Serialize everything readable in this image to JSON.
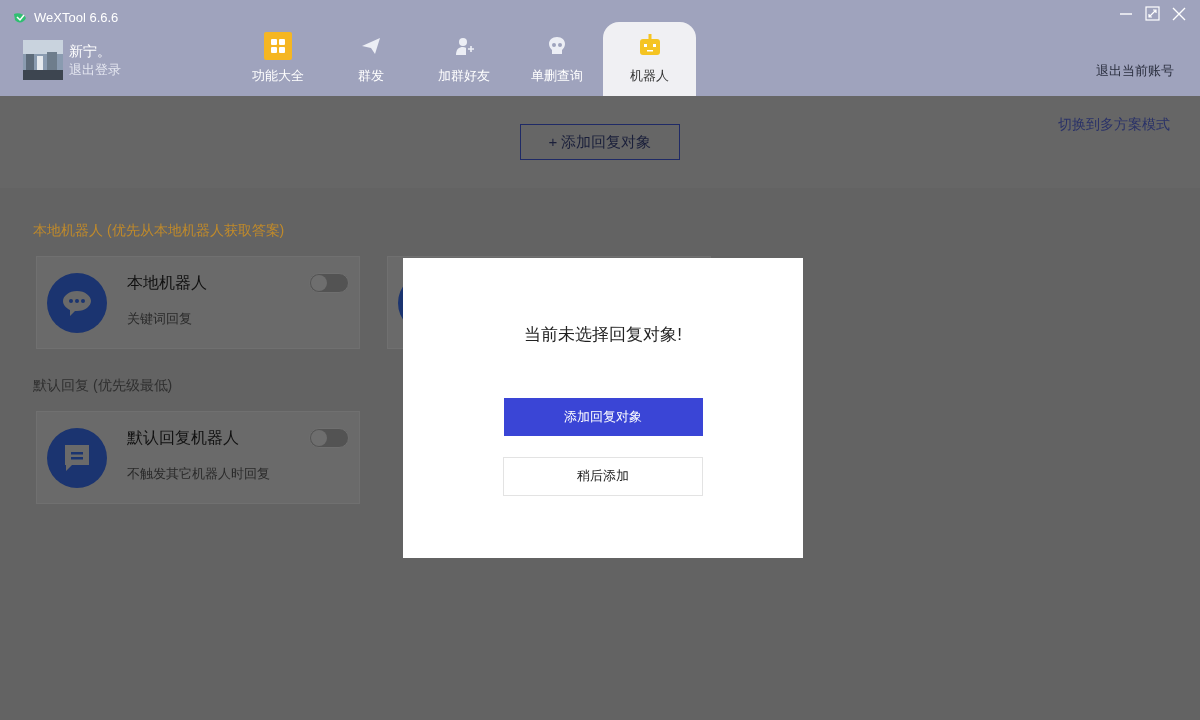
{
  "window": {
    "title": "WeXTool 6.6.6"
  },
  "user": {
    "name": "新宁。",
    "logout": "退出登录"
  },
  "tabs": [
    {
      "label": "功能大全",
      "kind": "grid",
      "selected": false
    },
    {
      "label": "群发",
      "kind": "plane",
      "selected": false
    },
    {
      "label": "加群好友",
      "kind": "person",
      "selected": false
    },
    {
      "label": "单删查询",
      "kind": "skull",
      "selected": false
    },
    {
      "label": "机器人",
      "kind": "robot",
      "selected": true
    }
  ],
  "exit_account": "退出当前账号",
  "switch_mode": "切换到多方案模式",
  "add_button": "+ 添加回复对象",
  "sections": [
    {
      "title": "本地机器人 (优先从本地机器人获取答案)",
      "kind": "accent",
      "cards": [
        {
          "title": "本地机器人",
          "subtitle": "关键词回复",
          "kind": "dots",
          "on": false
        }
      ]
    },
    {
      "title": "默认回复 (优先级最低)",
      "kind": "plain",
      "cards": [
        {
          "title": "默认回复机器人",
          "subtitle": "不触发其它机器人时回复",
          "kind": "lines",
          "on": false
        }
      ]
    }
  ],
  "dialog": {
    "message": "当前未选择回复对象!",
    "primary": "添加回复对象",
    "secondary": "稍后添加"
  }
}
